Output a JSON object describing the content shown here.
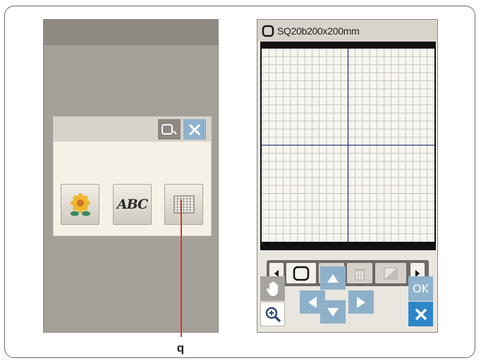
{
  "screen_right": {
    "title": "SQ20b200x200mm",
    "frame_icon": "rounded-square-icon",
    "toolbar": {
      "buttons": [
        "scroll-left-icon",
        "hoop-select-icon",
        "copy-icon",
        "delete-icon",
        "rotate-icon",
        "scroll-right-icon"
      ]
    },
    "nav": {
      "hand": "hand-icon",
      "zoom": "zoom-in-icon",
      "up": "arrow-up-icon",
      "down": "arrow-down-icon",
      "left": "arrow-left-icon",
      "right": "arrow-right-icon",
      "ok_label": "OK",
      "close": "close-icon"
    },
    "grid": {
      "divisions": 24
    }
  },
  "screen_left": {
    "dialog": {
      "frame_icon": "frame-select-icon",
      "close_icon": "close-icon",
      "categories": [
        {
          "name": "built-in-designs",
          "icon": "flower-icon"
        },
        {
          "name": "monogramming",
          "label": "ABC"
        },
        {
          "name": "grid-template",
          "icon": "grid-icon"
        }
      ]
    }
  },
  "callout": {
    "label": "q"
  },
  "colors": {
    "screen_gray": "#a59f99",
    "accent_blue": "#8eb2cc",
    "grid_line": "#c9c4bc",
    "axis_line": "#2b3a7a",
    "callout_red": "#d9362c"
  }
}
